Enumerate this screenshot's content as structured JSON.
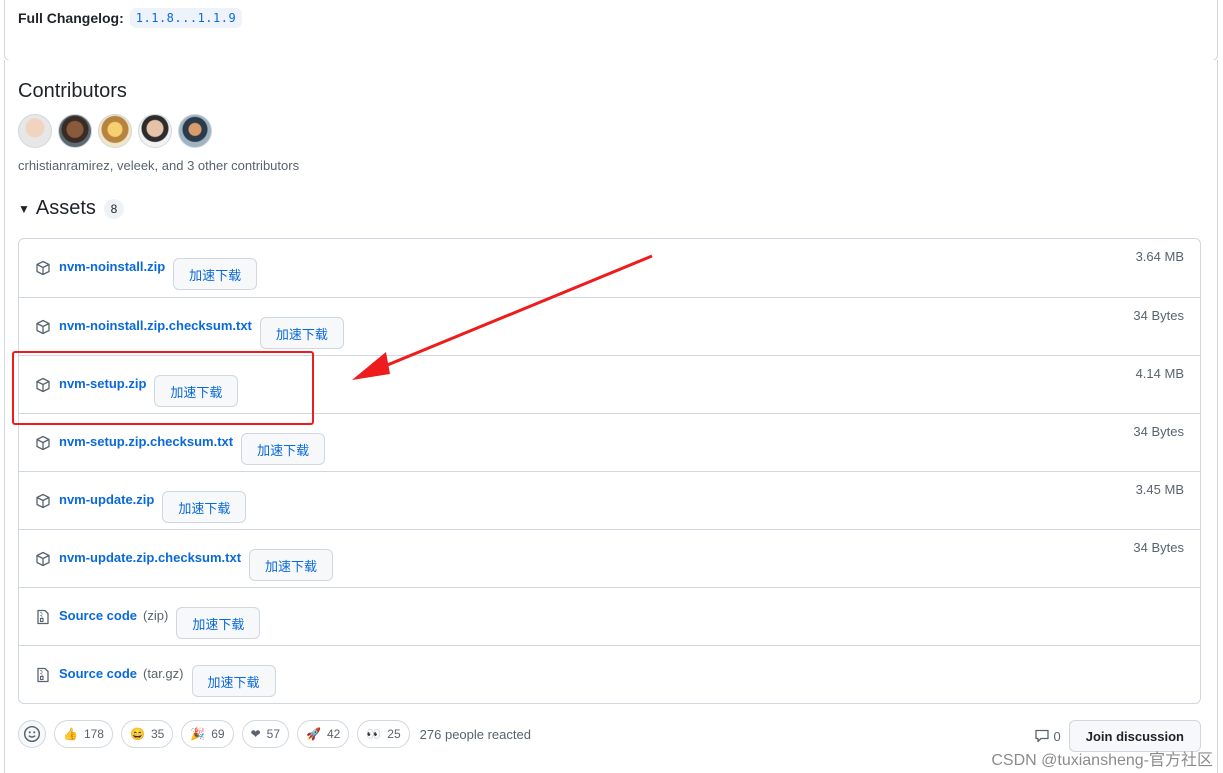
{
  "changelog": {
    "label": "Full Changelog:",
    "compare": "1.1.8...1.1.9"
  },
  "contributors": {
    "title": "Contributors",
    "summary": "crhistianramirez, veleek, and 3 other contributors"
  },
  "assets": {
    "title": "Assets",
    "count": "8",
    "download_label": "加速下载",
    "items": [
      {
        "name": "nvm-noinstall.zip",
        "suffix": "",
        "size": "3.64 MB",
        "icon": "package-icon"
      },
      {
        "name": "nvm-noinstall.zip.checksum.txt",
        "suffix": "",
        "size": "34 Bytes",
        "icon": "package-icon"
      },
      {
        "name": "nvm-setup.zip",
        "suffix": "",
        "size": "4.14 MB",
        "icon": "package-icon"
      },
      {
        "name": "nvm-setup.zip.checksum.txt",
        "suffix": "",
        "size": "34 Bytes",
        "icon": "package-icon"
      },
      {
        "name": "nvm-update.zip",
        "suffix": "",
        "size": "3.45 MB",
        "icon": "package-icon"
      },
      {
        "name": "nvm-update.zip.checksum.txt",
        "suffix": "",
        "size": "34 Bytes",
        "icon": "package-icon"
      },
      {
        "name": "Source code",
        "suffix": "(zip)",
        "size": "",
        "icon": "file-zip-icon"
      },
      {
        "name": "Source code",
        "suffix": "(tar.gz)",
        "size": "",
        "icon": "file-zip-icon"
      }
    ]
  },
  "reactions": {
    "items": [
      {
        "emoji": "👍",
        "count": "178"
      },
      {
        "emoji": "😄",
        "count": "35"
      },
      {
        "emoji": "🎉",
        "count": "69"
      },
      {
        "emoji": "❤",
        "count": "57"
      },
      {
        "emoji": "🚀",
        "count": "42"
      },
      {
        "emoji": "👀",
        "count": "25"
      }
    ],
    "summary": "276 people reacted"
  },
  "discussion": {
    "comments": "0",
    "join_label": "Join discussion"
  },
  "watermark": "CSDN @tuxiansheng-官方社区",
  "colors": {
    "link": "#0969da",
    "highlight": "#ee1c1c",
    "border": "#d0d7de"
  }
}
